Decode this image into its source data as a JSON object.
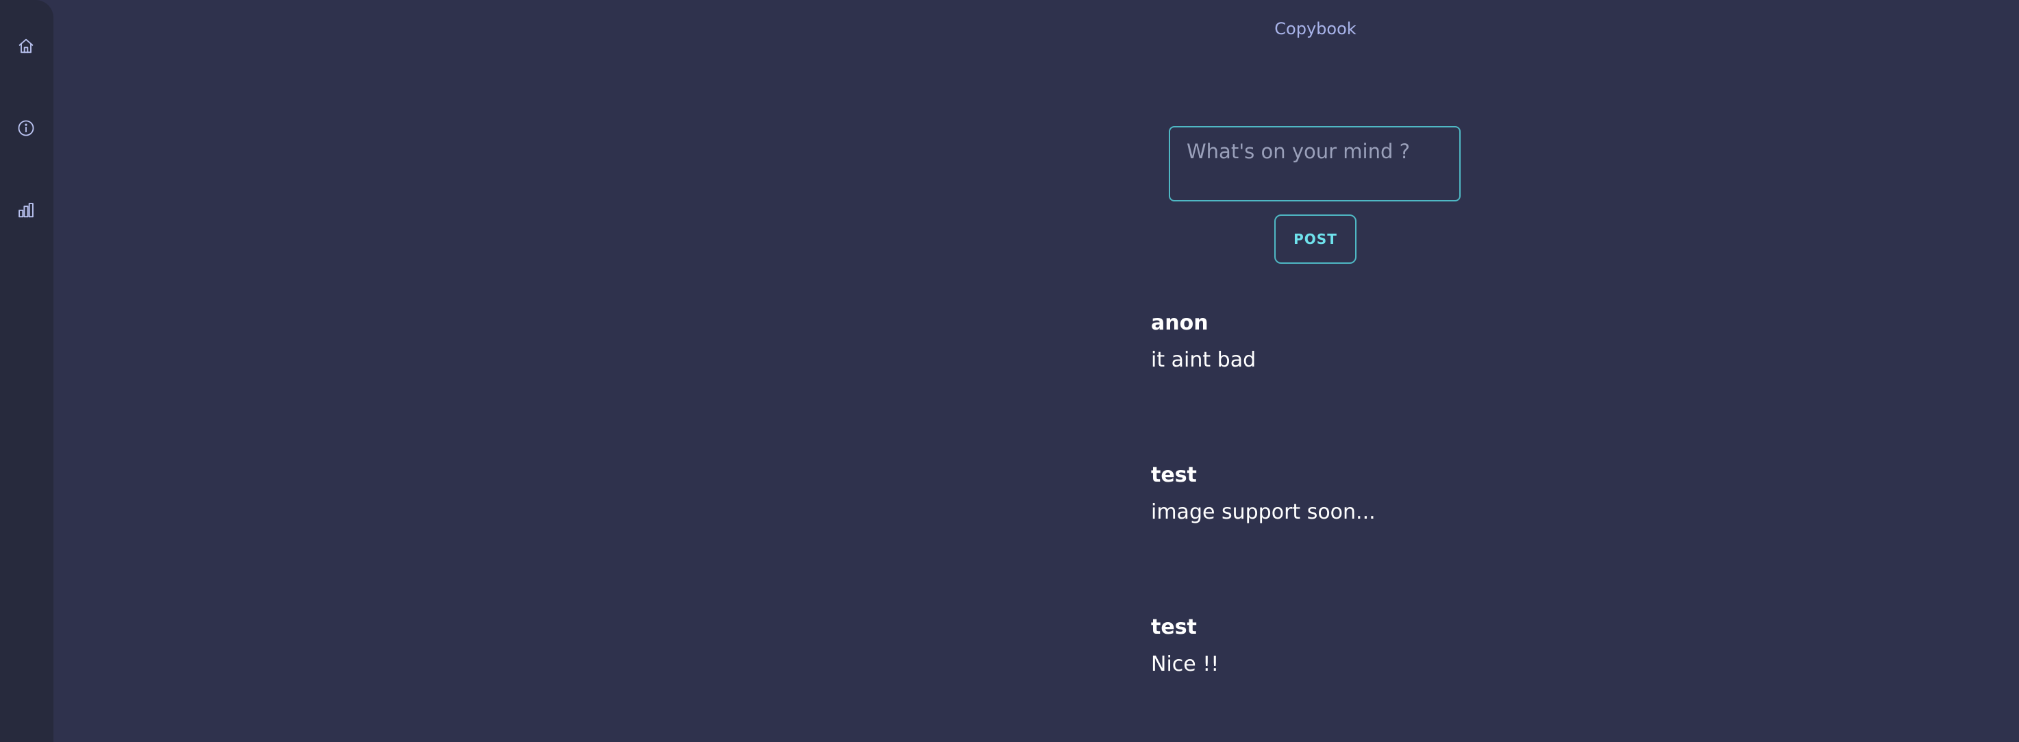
{
  "app": {
    "title": "Copybook"
  },
  "sidebar": {
    "items": [
      {
        "icon": "home-icon"
      },
      {
        "icon": "info-icon"
      },
      {
        "icon": "bar-chart-icon"
      }
    ]
  },
  "composer": {
    "placeholder": "What's on your mind ?",
    "value": "",
    "post_label": "POST"
  },
  "feed": {
    "posts": [
      {
        "author": "anon",
        "text": "it aint bad"
      },
      {
        "author": "test",
        "text": "image support soon..."
      },
      {
        "author": "test",
        "text": "Nice !!"
      }
    ]
  },
  "colors": {
    "background": "#2f324d",
    "sidebar": "#272a3d",
    "accent": "#4fb8c4",
    "title": "#a9b4ea"
  }
}
